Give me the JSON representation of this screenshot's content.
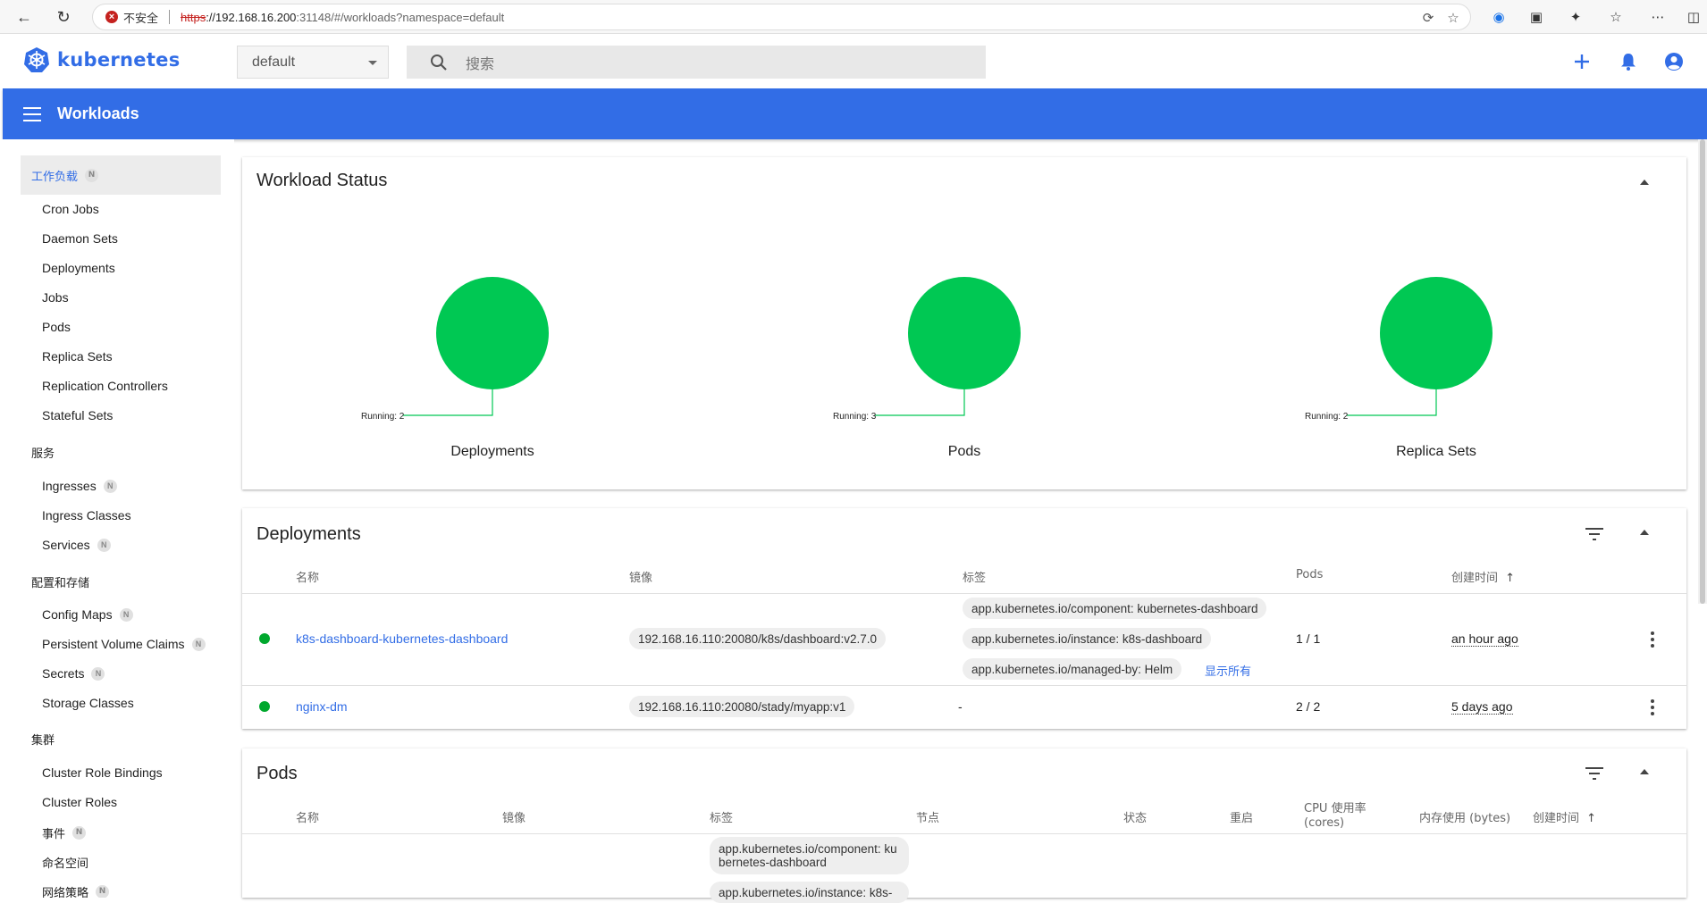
{
  "browser": {
    "insecure_label": "不安全",
    "url_scheme": "https",
    "url_host": "://192.168.16.200",
    "url_rest": ":31148/#/workloads?namespace=default"
  },
  "header": {
    "logo_text": "kubernetes",
    "namespace": "default",
    "search_placeholder": "搜索"
  },
  "toolbar": {
    "title": "Workloads"
  },
  "sidebar": {
    "workloads_label": "工作负载",
    "workload_items": [
      "Cron Jobs",
      "Daemon Sets",
      "Deployments",
      "Jobs",
      "Pods",
      "Replica Sets",
      "Replication Controllers",
      "Stateful Sets"
    ],
    "services_label": "服务",
    "service_items": [
      "Ingresses",
      "Ingress Classes",
      "Services"
    ],
    "config_label": "配置和存储",
    "config_items": [
      "Config Maps",
      "Persistent Volume Claims",
      "Secrets",
      "Storage Classes"
    ],
    "cluster_label": "集群",
    "cluster_items": [
      "Cluster Role Bindings",
      "Cluster Roles",
      "事件",
      "命名空间",
      "网络策略"
    ],
    "badge": "N"
  },
  "workload_status": {
    "title": "Workload Status",
    "items": [
      {
        "name": "Deployments",
        "running_label": "Running: 2",
        "running": 2,
        "total": 2
      },
      {
        "name": "Pods",
        "running_label": "Running: 3",
        "running": 3,
        "total": 3
      },
      {
        "name": "Replica Sets",
        "running_label": "Running: 2",
        "running": 2,
        "total": 2
      }
    ],
    "running_color": "#00c853"
  },
  "deployments": {
    "title": "Deployments",
    "columns": {
      "name": "名称",
      "image": "镜像",
      "labels": "标签",
      "pods": "Pods",
      "created": "创建时间"
    },
    "rows": [
      {
        "name": "k8s-dashboard-kubernetes-dashboard",
        "image": "192.168.16.110:20080/k8s/dashboard:v2.7.0",
        "labels": [
          "app.kubernetes.io/component: kubernetes-dashboard",
          "app.kubernetes.io/instance: k8s-dashboard",
          "app.kubernetes.io/managed-by: Helm"
        ],
        "show_all": "显示所有",
        "pods": "1 / 1",
        "created": "an hour ago"
      },
      {
        "name": "nginx-dm",
        "image": "192.168.16.110:20080/stady/myapp:v1",
        "labels_text": "-",
        "pods": "2 / 2",
        "created": "5 days ago"
      }
    ]
  },
  "pods": {
    "title": "Pods",
    "columns": {
      "name": "名称",
      "image": "镜像",
      "labels": "标签",
      "node": "节点",
      "status": "状态",
      "restarts": "重启",
      "cpu": "CPU 使用率 (cores)",
      "memory": "内存使用 (bytes)",
      "created": "创建时间"
    },
    "first_row_labels": [
      "app.kubernetes.io/component: kubernetes-dashboard",
      "app.kubernetes.io/instance: k8s-"
    ]
  }
}
